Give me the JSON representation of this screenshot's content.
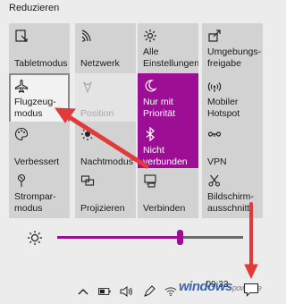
{
  "panel": {
    "collapse_label": "Reduzieren"
  },
  "tiles": [
    {
      "id": "tabletmodus",
      "label": "Tabletmodus",
      "icon": "tablet-mode-icon",
      "state": "normal"
    },
    {
      "id": "netzwerk",
      "label": "Netzwerk",
      "icon": "network-icon",
      "state": "normal"
    },
    {
      "id": "alle-einstellungen",
      "label": "Alle\nEinstellungen",
      "icon": "gear-icon",
      "state": "normal"
    },
    {
      "id": "umgebungsfreigabe",
      "label": "Umgebungs-\nfreigabe",
      "icon": "share-icon",
      "state": "normal"
    },
    {
      "id": "flugzeugmodus",
      "label": "Flugzeug-\nmodus",
      "icon": "airplane-icon",
      "state": "focus"
    },
    {
      "id": "position",
      "label": "Position",
      "icon": "location-icon",
      "state": "off"
    },
    {
      "id": "nur-mit-prioritaet",
      "label": "Nur mit\nPriorität",
      "icon": "moon-icon",
      "state": "on"
    },
    {
      "id": "mobiler-hotspot",
      "label": "Mobiler\nHotspot",
      "icon": "hotspot-icon",
      "state": "normal"
    },
    {
      "id": "verbessert",
      "label": "Verbessert",
      "icon": "palette-icon",
      "state": "normal"
    },
    {
      "id": "nachtmodus",
      "label": "Nachtmodus",
      "icon": "night-light-icon",
      "state": "normal"
    },
    {
      "id": "bluetooth",
      "label": "Nicht\nverbunden",
      "icon": "bluetooth-icon",
      "state": "on"
    },
    {
      "id": "vpn",
      "label": "VPN",
      "icon": "vpn-icon",
      "state": "normal"
    },
    {
      "id": "stromsparmodus",
      "label": "Strompar-\nmodus",
      "icon": "battery-saver-icon",
      "state": "normal"
    },
    {
      "id": "projizieren",
      "label": "Projizieren",
      "icon": "project-icon",
      "state": "normal"
    },
    {
      "id": "verbinden",
      "label": "Verbinden",
      "icon": "connect-icon",
      "state": "normal"
    },
    {
      "id": "bildschirmausschnitt",
      "label": "Bildschirm-\nausschnitt",
      "icon": "snip-icon",
      "state": "normal"
    }
  ],
  "brightness": {
    "icon": "brightness-icon",
    "level_percent": 66
  },
  "taskbar": {
    "tray_icons": [
      "chevron-up-icon",
      "battery-icon",
      "volume-icon",
      "pen-icon",
      "wifi-icon"
    ],
    "clock_time": "09:33",
    "clock_date": "",
    "notification_icon": "action-center-icon"
  },
  "watermark": {
    "brand": "windows",
    "suffix": "power.de"
  },
  "colors": {
    "accent": "#9c0f95",
    "arrow": "#e03a3a",
    "tile": "#d2d2d2",
    "background": "#ececec"
  }
}
